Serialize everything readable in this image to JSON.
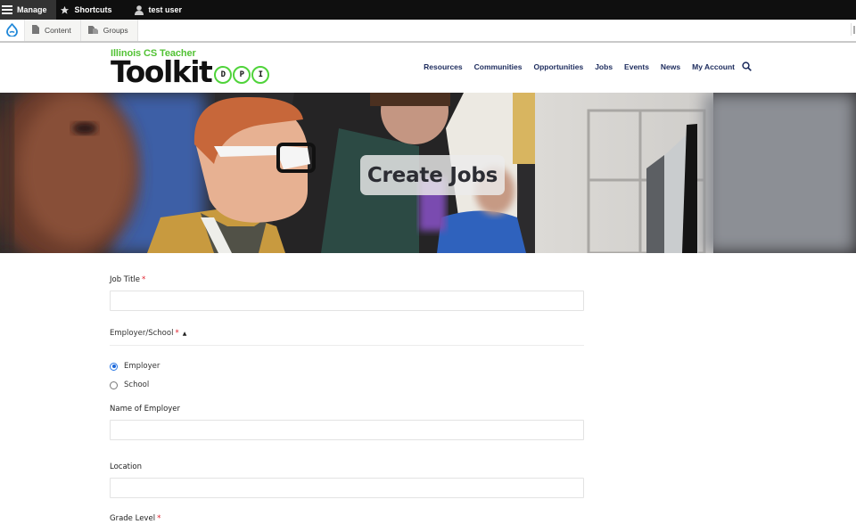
{
  "admin_toolbar": {
    "items": [
      {
        "label": "Manage",
        "icon": "hamburger-icon"
      },
      {
        "label": "Shortcuts",
        "icon": "star-icon"
      },
      {
        "label": "test user",
        "icon": "user-icon"
      }
    ]
  },
  "admin_tray": {
    "logo_icon": "drupal-drop-icon",
    "items": [
      {
        "label": "Content",
        "icon": "file-icon"
      },
      {
        "label": "Groups",
        "icon": "groups-icon"
      }
    ]
  },
  "site": {
    "logo_subtitle": "Illinois CS Teacher",
    "logo_title": "Toolkit",
    "logo_badge_letters": [
      "D",
      "P",
      "I"
    ],
    "brand_green": "#4fd33a",
    "nav_color": "#1b2a5c"
  },
  "nav": {
    "items": [
      "Resources",
      "Communities",
      "Opportunities",
      "Jobs",
      "Events",
      "News",
      "My Account"
    ],
    "search_icon": "search-icon"
  },
  "hero": {
    "title": "Create Jobs"
  },
  "form": {
    "job_title": {
      "label": "Job Title",
      "required": "*",
      "value": ""
    },
    "employer_school": {
      "legend": "Employer/School",
      "required": "*",
      "toggle": "▲",
      "options": [
        {
          "label": "Employer",
          "checked": true
        },
        {
          "label": "School",
          "checked": false
        }
      ]
    },
    "name_of_employer": {
      "label": "Name of Employer",
      "value": ""
    },
    "location": {
      "label": "Location",
      "value": ""
    },
    "grade_level": {
      "label": "Grade Level",
      "required": "*"
    }
  }
}
